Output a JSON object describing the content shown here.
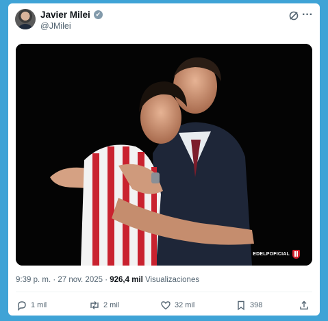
{
  "post": {
    "author_name": "Javier Milei",
    "handle": "@JMilei",
    "verified_mark": "✔",
    "more_glyph": "···",
    "media": {
      "watermark": "EDELPOFICIAL"
    },
    "timestamp": "9:39 p. m. · 27 nov. 2025 ·",
    "views_count": "926,4 mil",
    "views_label": "Visualizaciones"
  },
  "actions": {
    "replies": "1 mil",
    "reposts": "2 mil",
    "likes": "32 mil",
    "bookmarks": "398"
  },
  "icons": [
    "verified-badge-icon",
    "grok-icon",
    "more-icon",
    "reply-icon",
    "repost-icon",
    "like-icon",
    "bookmark-icon",
    "share-icon",
    "club-shield-icon"
  ],
  "colors": {
    "background": "#3fa3d6",
    "card": "#ffffff",
    "text_primary": "#0f1419",
    "text_secondary": "#536471",
    "verified_badge": "#829aab",
    "club_red": "#d21f2b"
  }
}
